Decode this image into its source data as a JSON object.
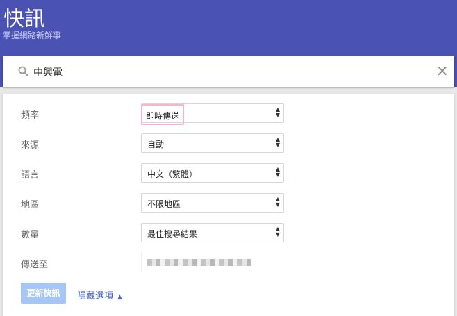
{
  "header": {
    "title": "快訊",
    "subtitle": "掌握網路新鮮事"
  },
  "search": {
    "query": "中興電",
    "close_icon": "×"
  },
  "options": [
    {
      "label": "頻率",
      "value": "即時傳送"
    },
    {
      "label": "來源",
      "value": "自動"
    },
    {
      "label": "語言",
      "value": "中文（繁體）"
    },
    {
      "label": "地區",
      "value": "不限地區"
    },
    {
      "label": "數量",
      "value": "最佳搜尋結果"
    }
  ],
  "deliver_to": {
    "label": "傳送至"
  },
  "actions": {
    "update": "更新快訊",
    "hide_options": "隱藏選項",
    "hide_arrow": "▲"
  }
}
